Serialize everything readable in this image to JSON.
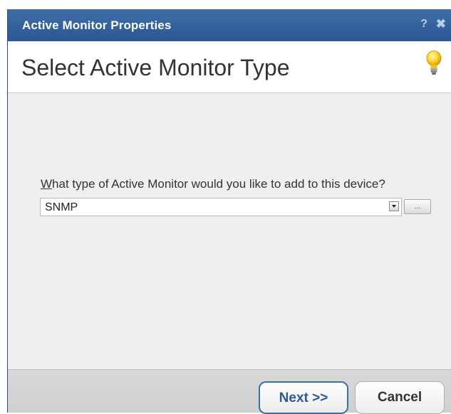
{
  "window": {
    "title": "Active Monitor Properties",
    "help_label": "?",
    "close_label": "✖"
  },
  "header": {
    "title": "Select Active Monitor Type",
    "tip_icon": "lightbulb-icon"
  },
  "form": {
    "question_accel": "W",
    "question_rest": "hat type of Active Monitor would you like to add to this device?",
    "monitor_type_value": "SNMP",
    "browse_label": "..."
  },
  "footer": {
    "next_label": "Next >>",
    "cancel_label": "Cancel"
  },
  "colors": {
    "titlebar": "#2b5794",
    "accent": "#3f6ea7",
    "body": "#efefef"
  }
}
